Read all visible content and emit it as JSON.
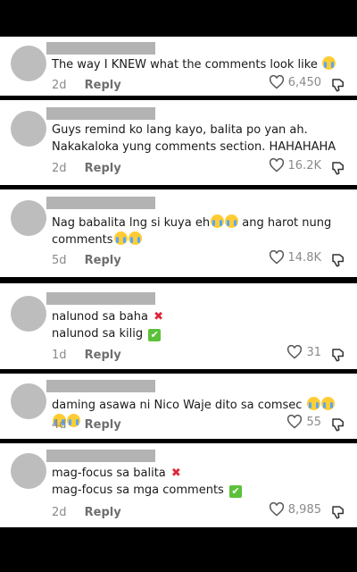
{
  "comments": [
    {
      "text": "The way I KNEW what the comments look like",
      "text_line2": "",
      "age": "2d",
      "reply_label": "Reply",
      "likes": "6,450"
    },
    {
      "text": "Guys remind ko lang kayo, balita po yan ah. Nakakaloka yung comments section. HAHAHAHA",
      "text_line2": "",
      "age": "2d",
      "reply_label": "Reply",
      "likes": "16.2K"
    },
    {
      "text": "Nag babalita lng si kuya eh",
      "text_after": "ang harot nung comments",
      "age": "5d",
      "reply_label": "Reply",
      "likes": "14.8K"
    },
    {
      "text": "nalunod sa baha",
      "text_line2": "nalunod sa kilig",
      "age": "1d",
      "reply_label": "Reply",
      "likes": "31"
    },
    {
      "text": "daming asawa ni Nico Waje dito sa comsec",
      "age": "4d",
      "reply_label": "Reply",
      "likes": "55"
    },
    {
      "text": "mag-focus sa balita",
      "text_line2": "mag-focus sa mga comments",
      "age": "2d",
      "reply_label": "Reply",
      "likes": "8,985"
    }
  ],
  "colors": {
    "background": "#000000",
    "card": "#ffffff",
    "text": "#1a1a1a",
    "meta": "#8a8a8a",
    "redaction": "#b3b3b3",
    "avatar": "#bdbdbd"
  },
  "icons": {
    "like": "heart-outline-icon",
    "dislike": "thumbs-down-outline-icon",
    "emoji_crying": "loudly-crying-face-emoji",
    "emoji_x": "cross-mark-emoji",
    "emoji_check": "check-mark-button-emoji"
  }
}
